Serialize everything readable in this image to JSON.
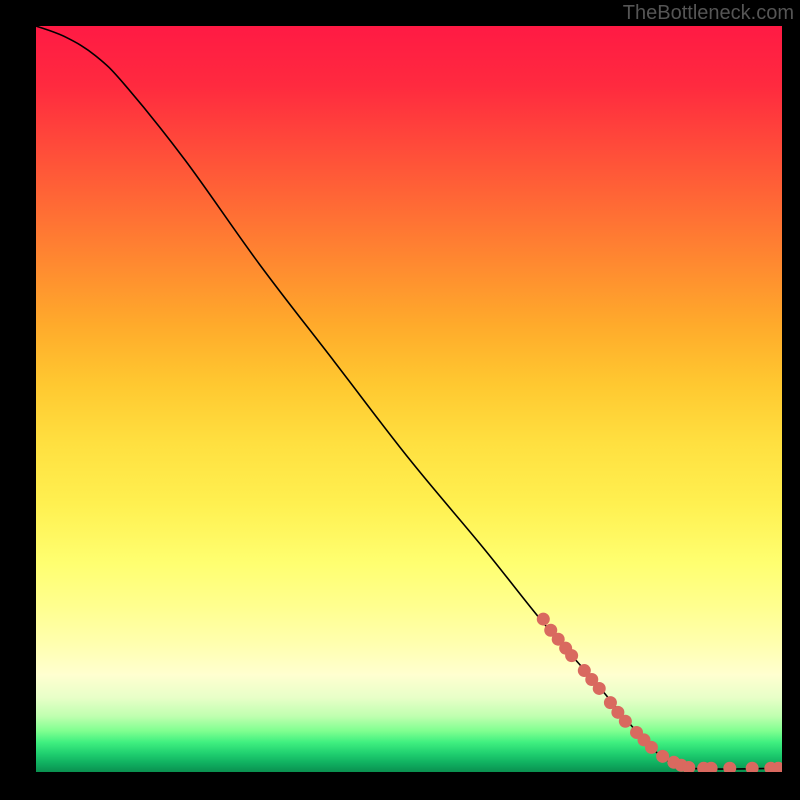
{
  "watermark": "TheBottleneck.com",
  "chart_data": {
    "type": "line",
    "title": "",
    "xlabel": "",
    "ylabel": "",
    "xlim": [
      0,
      100
    ],
    "ylim": [
      0,
      100
    ],
    "curve": [
      {
        "x": 0,
        "y": 100
      },
      {
        "x": 4,
        "y": 98.5
      },
      {
        "x": 8,
        "y": 96
      },
      {
        "x": 12,
        "y": 92
      },
      {
        "x": 20,
        "y": 82
      },
      {
        "x": 30,
        "y": 68
      },
      {
        "x": 40,
        "y": 55
      },
      {
        "x": 50,
        "y": 42
      },
      {
        "x": 60,
        "y": 30
      },
      {
        "x": 68,
        "y": 20
      },
      {
        "x": 75,
        "y": 12
      },
      {
        "x": 80,
        "y": 6
      },
      {
        "x": 84,
        "y": 2
      },
      {
        "x": 88,
        "y": 0.5
      },
      {
        "x": 100,
        "y": 0.5
      }
    ],
    "markers": [
      {
        "x": 68.0,
        "y": 20.5
      },
      {
        "x": 69.0,
        "y": 19.0
      },
      {
        "x": 70.0,
        "y": 17.8
      },
      {
        "x": 71.0,
        "y": 16.6
      },
      {
        "x": 71.8,
        "y": 15.6
      },
      {
        "x": 73.5,
        "y": 13.6
      },
      {
        "x": 74.5,
        "y": 12.4
      },
      {
        "x": 75.5,
        "y": 11.2
      },
      {
        "x": 77.0,
        "y": 9.3
      },
      {
        "x": 78.0,
        "y": 8.0
      },
      {
        "x": 79.0,
        "y": 6.8
      },
      {
        "x": 80.5,
        "y": 5.3
      },
      {
        "x": 81.5,
        "y": 4.3
      },
      {
        "x": 82.5,
        "y": 3.3
      },
      {
        "x": 84.0,
        "y": 2.1
      },
      {
        "x": 85.5,
        "y": 1.3
      },
      {
        "x": 86.5,
        "y": 0.9
      },
      {
        "x": 87.5,
        "y": 0.6
      },
      {
        "x": 89.5,
        "y": 0.5
      },
      {
        "x": 90.5,
        "y": 0.5
      },
      {
        "x": 93.0,
        "y": 0.5
      },
      {
        "x": 96.0,
        "y": 0.5
      },
      {
        "x": 98.5,
        "y": 0.5
      },
      {
        "x": 99.5,
        "y": 0.5
      }
    ],
    "marker_color": "#d9695f",
    "line_color": "#000000"
  }
}
